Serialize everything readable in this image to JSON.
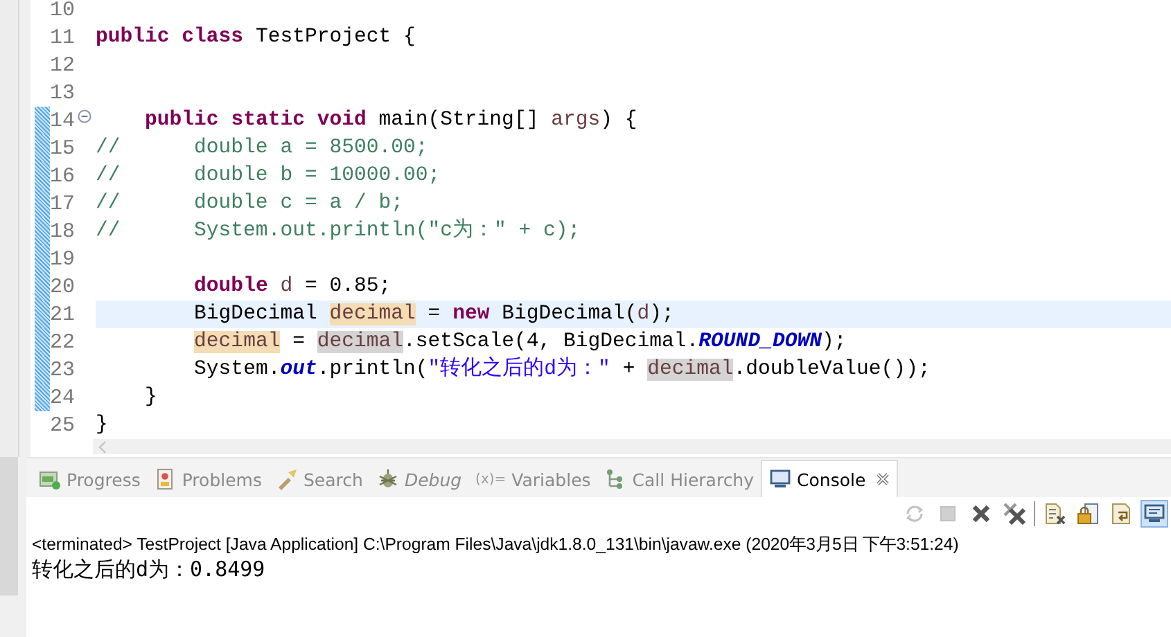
{
  "editor": {
    "lines": [
      {
        "number": "10",
        "changed": false,
        "current": false,
        "fold": false
      },
      {
        "number": "11",
        "changed": false,
        "current": false,
        "fold": false,
        "tokens": [
          {
            "kind": "keyword",
            "text": "public class"
          },
          {
            "kind": "plain",
            "text": " TestProject {"
          }
        ]
      },
      {
        "number": "12",
        "changed": false,
        "current": false,
        "fold": false
      },
      {
        "number": "13",
        "changed": false,
        "current": false,
        "fold": false
      },
      {
        "number": "14",
        "changed": true,
        "current": false,
        "fold": true,
        "tokens": [
          {
            "kind": "keyword",
            "text": "    public static void"
          },
          {
            "kind": "plain",
            "text": " main(String[] "
          },
          {
            "kind": "local",
            "text": "args"
          },
          {
            "kind": "plain",
            "text": ") {"
          }
        ]
      },
      {
        "number": "15",
        "changed": true,
        "current": false,
        "fold": false,
        "tokens": [
          {
            "kind": "comment",
            "text": "//      double a = 8500.00;"
          }
        ]
      },
      {
        "number": "16",
        "changed": true,
        "current": false,
        "fold": false,
        "tokens": [
          {
            "kind": "comment",
            "text": "//      double b = 10000.00;"
          }
        ]
      },
      {
        "number": "17",
        "changed": true,
        "current": false,
        "fold": false,
        "tokens": [
          {
            "kind": "comment",
            "text": "//      double c = a / b;"
          }
        ]
      },
      {
        "number": "18",
        "changed": true,
        "current": false,
        "fold": false,
        "tokens": [
          {
            "kind": "comment",
            "text": "//      System.out.println(\"c为：\" + c);"
          }
        ]
      },
      {
        "number": "19",
        "changed": true,
        "current": false,
        "fold": false
      },
      {
        "number": "20",
        "changed": true,
        "current": false,
        "fold": false,
        "tokens": [
          {
            "kind": "keyword",
            "text": "        double"
          },
          {
            "kind": "local",
            "text": " d"
          },
          {
            "kind": "plain",
            "text": " = 0.85;"
          }
        ]
      },
      {
        "number": "21",
        "changed": true,
        "current": true,
        "fold": false,
        "tokens": [
          {
            "kind": "plain",
            "text": "        BigDecimal "
          },
          {
            "kind": "write",
            "text": "decimal"
          },
          {
            "kind": "plain",
            "text": " = "
          },
          {
            "kind": "keyword",
            "text": "new"
          },
          {
            "kind": "plain",
            "text": " BigDecimal("
          },
          {
            "kind": "local",
            "text": "d"
          },
          {
            "kind": "plain",
            "text": ");"
          }
        ]
      },
      {
        "number": "22",
        "changed": true,
        "current": false,
        "fold": false,
        "tokens": [
          {
            "kind": "write",
            "text": "        decimal"
          },
          {
            "kind": "plain",
            "text": " = "
          },
          {
            "kind": "read",
            "text": "decimal"
          },
          {
            "kind": "plain",
            "text": ".setScale(4, BigDecimal."
          },
          {
            "kind": "static",
            "text": "ROUND_DOWN"
          },
          {
            "kind": "plain",
            "text": ");"
          }
        ]
      },
      {
        "number": "23",
        "changed": true,
        "current": false,
        "fold": false,
        "tokens": [
          {
            "kind": "plain",
            "text": "        System."
          },
          {
            "kind": "static",
            "text": "out"
          },
          {
            "kind": "plain",
            "text": ".println("
          },
          {
            "kind": "string",
            "text": "\"转化之后的d为：\""
          },
          {
            "kind": "plain",
            "text": " + "
          },
          {
            "kind": "read",
            "text": "decimal"
          },
          {
            "kind": "plain",
            "text": ".doubleValue());"
          }
        ]
      },
      {
        "number": "24",
        "changed": true,
        "current": false,
        "fold": false,
        "tokens": [
          {
            "kind": "plain",
            "text": "    }"
          }
        ]
      },
      {
        "number": "25",
        "changed": false,
        "current": false,
        "fold": false,
        "tokens": [
          {
            "kind": "plain",
            "text": "}"
          }
        ]
      }
    ]
  },
  "views": {
    "tabs": [
      {
        "kind": "progress",
        "label": "Progress",
        "selected": false
      },
      {
        "kind": "problems",
        "label": "Problems",
        "selected": false
      },
      {
        "kind": "search",
        "label": "Search",
        "selected": false
      },
      {
        "kind": "debug",
        "label": "Debug",
        "selected": false
      },
      {
        "kind": "variables",
        "glyph": "(x)=",
        "label": "Variables",
        "selected": false
      },
      {
        "kind": "hierarchy",
        "label": "Call Hierarchy",
        "selected": false
      },
      {
        "kind": "console",
        "label": "Console",
        "selected": true
      }
    ],
    "toolbar": [
      {
        "kind": "sync",
        "disabled": true,
        "selected": false
      },
      {
        "kind": "stop",
        "disabled": true,
        "selected": false
      },
      {
        "kind": "remove",
        "disabled": false,
        "selected": false
      },
      {
        "kind": "remove-all",
        "disabled": false,
        "selected": false
      },
      {
        "kind": "clear",
        "disabled": false,
        "selected": false
      },
      {
        "kind": "lock",
        "disabled": false,
        "selected": false
      },
      {
        "kind": "word-wrap",
        "disabled": false,
        "selected": false
      },
      {
        "kind": "display",
        "disabled": false,
        "selected": true
      }
    ]
  },
  "console": {
    "header": "<terminated> TestProject [Java Application] C:\\Program Files\\Java\\jdk1.8.0_131\\bin\\javaw.exe (2020年3月5日 下午3:51:24)",
    "output": [
      "转化之后的d为：0.8499"
    ]
  }
}
